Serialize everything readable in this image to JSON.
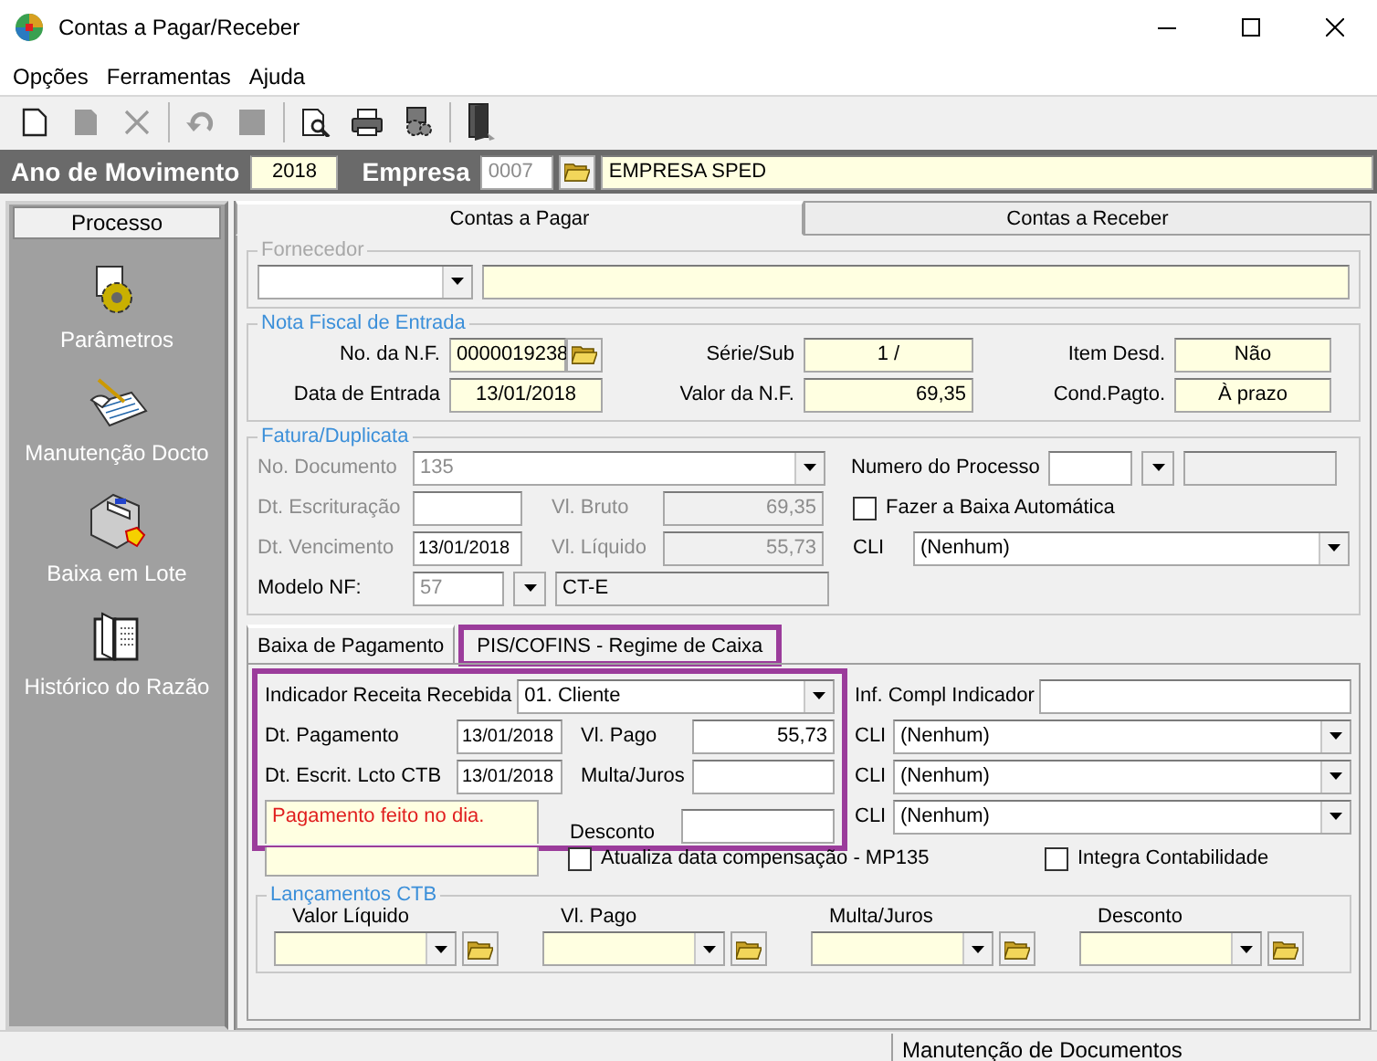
{
  "window": {
    "title": "Contas a Pagar/Receber"
  },
  "menu": [
    "Opções",
    "Ferramentas",
    "Ajuda"
  ],
  "toolbar": [
    {
      "buttons": [
        {
          "kind": "new",
          "disabled": false
        },
        {
          "kind": "edit",
          "disabled": true
        },
        {
          "kind": "delete",
          "disabled": true
        }
      ]
    },
    {
      "buttons": [
        {
          "kind": "undo",
          "disabled": true
        },
        {
          "kind": "stop",
          "disabled": true
        }
      ]
    },
    {
      "buttons": [
        {
          "kind": "preview",
          "disabled": false
        },
        {
          "kind": "print",
          "disabled": false
        },
        {
          "kind": "tools",
          "disabled": false
        }
      ]
    },
    {
      "buttons": [
        {
          "kind": "exit",
          "disabled": false
        }
      ]
    }
  ],
  "header": {
    "year_label": "Ano de Movimento",
    "year": "2018",
    "company_label": "Empresa",
    "company_code": "0007",
    "company_name": "EMPRESA SPED"
  },
  "sidebar": {
    "title": "Processo",
    "items": [
      {
        "kind": "parameters",
        "label": "Parâmetros"
      },
      {
        "kind": "maintenance",
        "label": "Manutenção Docto"
      },
      {
        "kind": "batch",
        "label": "Baixa em Lote"
      },
      {
        "kind": "history",
        "label": "Histórico do Razão"
      }
    ]
  },
  "tabs": [
    {
      "label": "Contas a Pagar",
      "selected": true
    },
    {
      "label": "Contas a Receber",
      "selected": false
    }
  ],
  "fornecedor": {
    "legend": "Fornecedor",
    "disabled": true
  },
  "nota_fiscal": {
    "legend": "Nota Fiscal de Entrada",
    "nf_number": {
      "label": "No. da N.F.",
      "value": "0000019238"
    },
    "entry_date": {
      "label": "Data de Entrada",
      "value": "13/01/2018"
    },
    "series": {
      "label": "Série/Sub",
      "value": "1 /"
    },
    "nf_value": {
      "label": "Valor da N.F.",
      "value": "69,35"
    },
    "item_desd": {
      "label": "Item Desd.",
      "value": "Não"
    },
    "payment_cond": {
      "label": "Cond.Pagto.",
      "value": "À prazo"
    }
  },
  "fatura": {
    "legend": "Fatura/Duplicata",
    "document": {
      "label": "No. Documento",
      "value": "135",
      "disabled": true
    },
    "dt_escrit": {
      "label": "Dt. Escrituração",
      "disabled": true
    },
    "dt_venc": {
      "label": "Dt. Vencimento",
      "value": "13/01/2018",
      "disabled": true
    },
    "vl_bruto": {
      "label": "Vl. Bruto",
      "value": "69,35",
      "disabled": true
    },
    "vl_liquido": {
      "label": "Vl. Líquido",
      "value": "55,73",
      "disabled": true
    },
    "modelo": {
      "label": "Modelo NF:",
      "code": "57",
      "name": "CT-E",
      "disabled": false
    },
    "processo": {
      "label": "Numero do Processo"
    },
    "baixa_auto": {
      "label": "Fazer a Baixa Automática",
      "checked": false
    },
    "cli": {
      "label": "CLI",
      "value": "(Nenhum)"
    }
  },
  "inner_tabs": [
    {
      "label": "Baixa de Pagamento",
      "selected": true,
      "highlighted": false
    },
    {
      "label": "PIS/COFINS - Regime de Caixa",
      "selected": false,
      "highlighted": true
    }
  ],
  "baixa": {
    "highlighted": true,
    "indicador": {
      "label": "Indicador Receita Recebida",
      "value": "01. Cliente"
    },
    "dt_pagamento": {
      "label": "Dt. Pagamento",
      "value": "13/01/2018"
    },
    "dt_escrit": {
      "label": "Dt. Escrit. Lcto CTB",
      "value": "13/01/2018"
    },
    "note": "Pagamento feito no dia.",
    "vl_pago": {
      "label": "Vl. Pago",
      "value": "55,73"
    },
    "multa": {
      "label": "Multa/Juros"
    },
    "desconto": {
      "label": "Desconto"
    },
    "inf_compl": {
      "label": "Inf. Compl Indicador"
    },
    "cli_rows": [
      {
        "label": "CLI",
        "value": "(Nenhum)"
      },
      {
        "label": "CLI",
        "value": "(Nenhum)"
      },
      {
        "label": "CLI",
        "value": "(Nenhum)"
      }
    ],
    "atualiza": {
      "label": "Atualiza data compensação - MP135",
      "checked": false
    },
    "integra": {
      "label": "Integra Contabilidade",
      "checked": false
    }
  },
  "lancamentos": {
    "legend": "Lançamentos CTB",
    "columns": [
      "Valor Líquido",
      "Vl. Pago",
      "Multa/Juros",
      "Desconto"
    ]
  },
  "status_bar": {
    "text": "Manutenção de Documentos"
  }
}
